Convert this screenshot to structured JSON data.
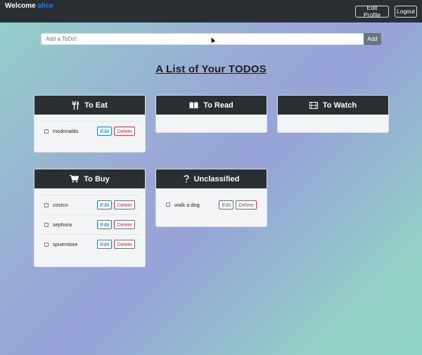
{
  "nav": {
    "welcome_label": "Welcome",
    "username": "alice",
    "edit_profile_label": "Edit Profile",
    "logout_label": "Logout"
  },
  "add_todo": {
    "placeholder": "Add a ToDo!",
    "button_label": "Add"
  },
  "page_title": "A List of Your TODOS",
  "cards": {
    "eat": {
      "title": "To Eat",
      "icon": "utensils-icon",
      "items": [
        "mcdonalds"
      ]
    },
    "read": {
      "title": "To Read",
      "icon": "book-icon",
      "items": []
    },
    "watch": {
      "title": "To Watch",
      "icon": "film-icon",
      "items": []
    },
    "buy": {
      "title": "To Buy",
      "icon": "cart-icon",
      "items": [
        "costco",
        "sephora",
        "spuerstore"
      ]
    },
    "unclassified": {
      "title": "Unclassified",
      "icon": "question-icon",
      "items": [
        "walk a dog"
      ]
    }
  },
  "item_buttons": {
    "edit": "Edit",
    "delete": "Delete"
  },
  "colors": {
    "navbar": "#2a2f34",
    "username": "#1e7bf0",
    "edit": "#1e7bf0",
    "delete": "#d6404f"
  }
}
